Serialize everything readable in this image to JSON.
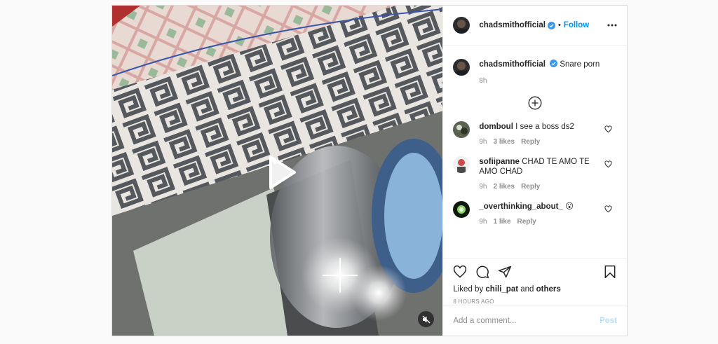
{
  "post": {
    "author": "chadsmithofficial",
    "follow_label": "Follow",
    "dot": "•",
    "caption_text": "Snare porn",
    "caption_time": "8h",
    "comments": [
      {
        "user": "domboul",
        "text": "I see a boss ds2",
        "time": "9h",
        "likes": "3 likes",
        "reply": "Reply"
      },
      {
        "user": "sofiipanne",
        "text": "CHAD TE AMO TE AMO CHAD",
        "time": "9h",
        "likes": "2 likes",
        "reply": "Reply"
      },
      {
        "user": "_overthinking_about_",
        "text": "😮",
        "time": "9h",
        "likes": "1 like",
        "reply": "Reply"
      }
    ],
    "liked_by_prefix": "Liked by",
    "liked_by_user": "chili_pat",
    "liked_by_and": "and",
    "liked_by_others": "others",
    "posted_ago": "8 HOURS AGO",
    "add_comment_placeholder": "Add a comment...",
    "post_label": "Post"
  },
  "icons": {
    "verified": "verified-badge-icon",
    "more": "more-options-icon",
    "load_more": "plus-circle-icon",
    "like": "heart-icon",
    "comment": "comment-icon",
    "share": "share-icon",
    "save": "bookmark-icon",
    "play": "play-icon",
    "mute": "muted-speaker-icon"
  },
  "colors": {
    "accent": "#0095f6",
    "post_disabled": "#b2dffc",
    "muted_text": "#8e8e8e",
    "border": "#dbdbdb"
  }
}
